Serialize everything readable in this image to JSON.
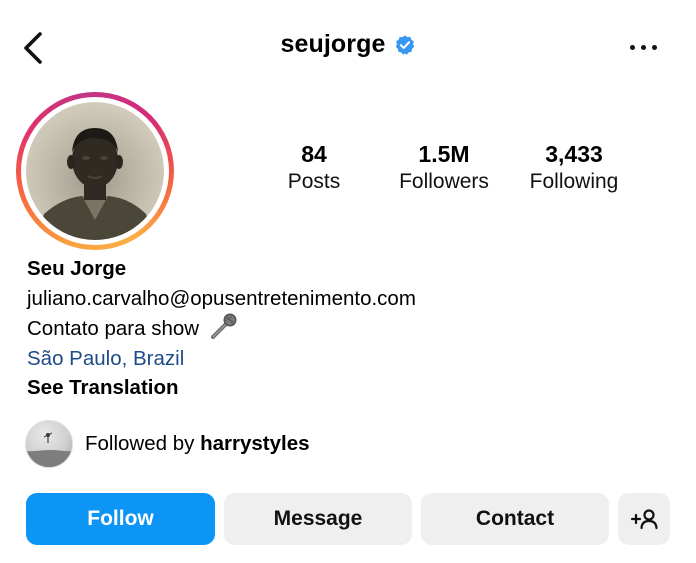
{
  "header": {
    "username": "seujorge",
    "verified": true
  },
  "stats": [
    {
      "value": "84",
      "label": "Posts"
    },
    {
      "value": "1.5M",
      "label": "Followers"
    },
    {
      "value": "3,433",
      "label": "Following"
    }
  ],
  "bio": {
    "name": "Seu Jorge",
    "email": "juliano.carvalho@opusentretenimento.com",
    "tagline": "Contato para show",
    "tagline_emoji": "microphone",
    "location": "São Paulo, Brazil",
    "translate_label": "See Translation"
  },
  "followed_by": {
    "prefix": "Followed by",
    "user": "harrystyles"
  },
  "actions": {
    "follow": "Follow",
    "message": "Message",
    "contact": "Contact"
  },
  "colors": {
    "follow_button": "#0d95f6",
    "secondary_button": "#efefef",
    "location_link": "#1f4a8a",
    "verified_badge": "#3897f0"
  }
}
